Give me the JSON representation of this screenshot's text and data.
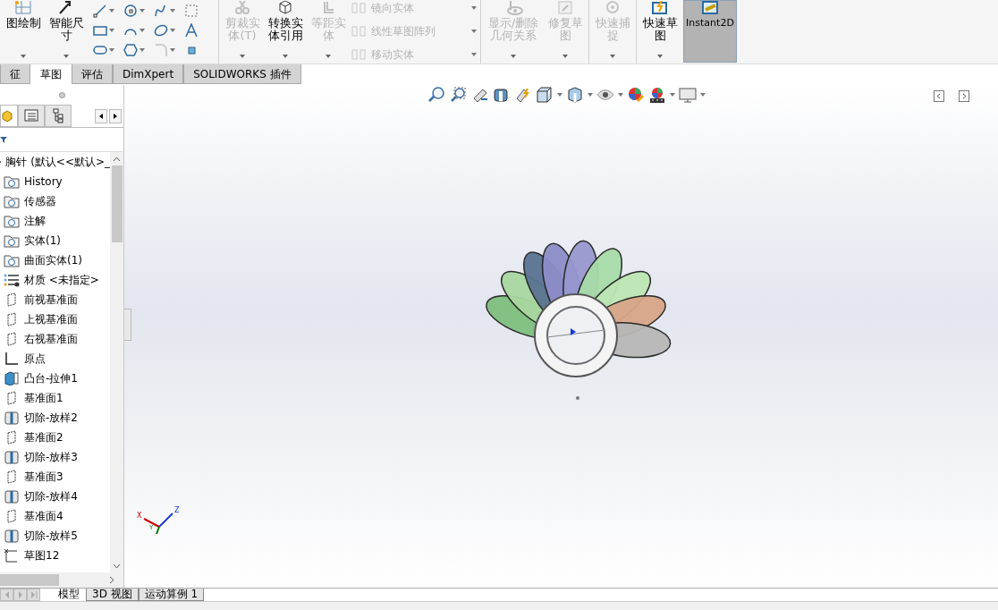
{
  "ribbon": {
    "groups": [
      {
        "commands": [
          {
            "kind": "large",
            "label": "图绘制",
            "disabled": false
          },
          {
            "kind": "large",
            "label": "智能尺寸",
            "disabled": false
          },
          {
            "kind": "tools"
          }
        ]
      },
      {
        "commands": [
          {
            "kind": "large",
            "label": "剪裁实体(T)",
            "disabled": true
          },
          {
            "kind": "large",
            "label": "转换实体引用",
            "disabled": false
          },
          {
            "kind": "large",
            "label": "等距实体",
            "disabled": true
          },
          {
            "kind": "stack",
            "items": [
              {
                "label": "镜向实体",
                "disabled": true
              },
              {
                "label": "线性草图阵列",
                "disabled": true
              },
              {
                "label": "移动实体",
                "disabled": true
              }
            ]
          }
        ]
      },
      {
        "commands": [
          {
            "kind": "wide",
            "label": "显示/删除几何关系",
            "disabled": true
          },
          {
            "kind": "large",
            "label": "修复草图",
            "disabled": true
          }
        ]
      },
      {
        "commands": [
          {
            "kind": "large",
            "label": "快速捕捉",
            "disabled": true
          }
        ]
      },
      {
        "commands": [
          {
            "kind": "large",
            "label": "快速草图",
            "disabled": false
          },
          {
            "kind": "toggle",
            "label": "Instant2D",
            "selected": true
          }
        ]
      }
    ]
  },
  "command_tabs": [
    {
      "label": "征",
      "selected": false
    },
    {
      "label": "草图",
      "selected": true
    },
    {
      "label": "评估",
      "selected": false
    },
    {
      "label": "DimXpert",
      "selected": false
    },
    {
      "label": "SOLIDWORKS 插件",
      "selected": false
    }
  ],
  "feature_tree": {
    "root": "胸针  (默认<<默认>_",
    "items": [
      {
        "label": "History",
        "kind": "folder"
      },
      {
        "label": "传感器",
        "kind": "folder"
      },
      {
        "label": "注解",
        "kind": "folder"
      },
      {
        "label": "实体(1)",
        "kind": "folder"
      },
      {
        "label": "曲面实体(1)",
        "kind": "folder"
      },
      {
        "label": "材质 <未指定>",
        "kind": "material"
      },
      {
        "label": "前视基准面",
        "kind": "plane"
      },
      {
        "label": "上视基准面",
        "kind": "plane"
      },
      {
        "label": "右视基准面",
        "kind": "plane"
      },
      {
        "label": "原点",
        "kind": "origin"
      },
      {
        "label": "凸台-拉伸1",
        "kind": "boss"
      },
      {
        "label": "基准面1",
        "kind": "plane"
      },
      {
        "label": "切除-放样2",
        "kind": "cut"
      },
      {
        "label": "基准面2",
        "kind": "plane"
      },
      {
        "label": "切除-放样3",
        "kind": "cut"
      },
      {
        "label": "基准面3",
        "kind": "plane"
      },
      {
        "label": "切除-放样4",
        "kind": "cut"
      },
      {
        "label": "基准面4",
        "kind": "plane"
      },
      {
        "label": "切除-放样5",
        "kind": "cut"
      },
      {
        "label": "草图12",
        "kind": "sketch"
      }
    ]
  },
  "triad": {
    "x": "X",
    "y": "Y",
    "z": "Z"
  },
  "bottom_tabs": [
    {
      "label": "模型",
      "selected": true
    },
    {
      "label": "3D 视图",
      "selected": false
    },
    {
      "label": "运动算例 1",
      "selected": false
    }
  ]
}
